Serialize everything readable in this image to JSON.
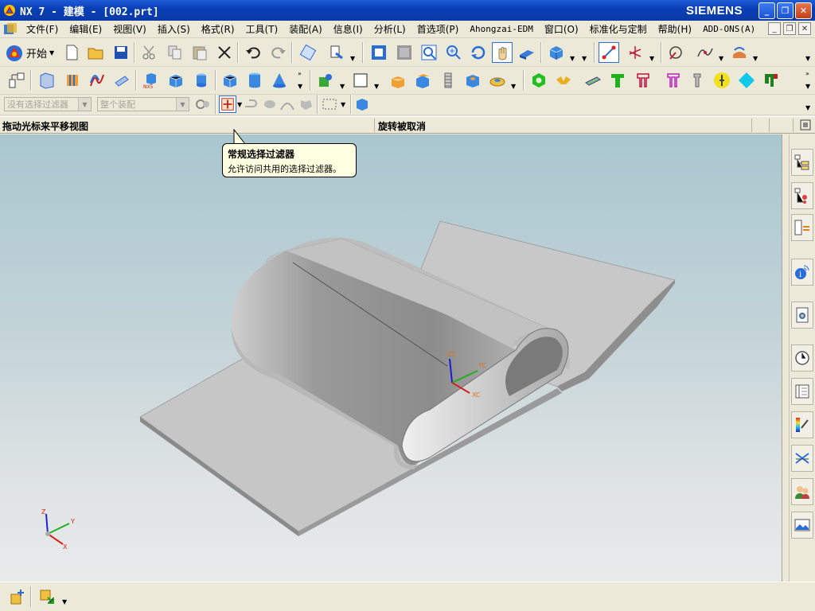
{
  "window": {
    "title": "NX 7 - 建模 - [002.prt]",
    "brand": "SIEMENS"
  },
  "window_buttons": {
    "minimize": "_",
    "restore": "❐",
    "close": "✕"
  },
  "menu": [
    {
      "label": "文件(F)"
    },
    {
      "label": "编辑(E)"
    },
    {
      "label": "视图(V)"
    },
    {
      "label": "插入(S)"
    },
    {
      "label": "格式(R)"
    },
    {
      "label": "工具(T)"
    },
    {
      "label": "装配(A)"
    },
    {
      "label": "信息(I)"
    },
    {
      "label": "分析(L)"
    },
    {
      "label": "首选项(P)"
    },
    {
      "label": "Ahongzai-EDM"
    },
    {
      "label": "窗口(O)"
    },
    {
      "label": "标准化与定制"
    },
    {
      "label": "帮助(H)"
    },
    {
      "label": "ADD-ONS(A)"
    }
  ],
  "toolbar": {
    "start_label": "开始"
  },
  "selection_bar": {
    "filter_placeholder": "没有选择过滤器",
    "scope_placeholder": "整个装配"
  },
  "cue_line": {
    "cue": "拖动光标来平移视图",
    "status": "旋转被取消"
  },
  "tooltip": {
    "title": "常规选择过滤器",
    "body": "允许访问共用的选择过滤器。"
  },
  "triad": {
    "zc": "ZC",
    "yc": "YC",
    "xc": "XC"
  },
  "view_triad": {
    "z": "Z",
    "y": "Y",
    "x": "X"
  },
  "colors": {
    "titlebar": "#0a3fb5",
    "viewport_top": "#a9c6cf",
    "viewport_bottom": "#e9ebeb",
    "tooltip": "#ffffe1"
  }
}
